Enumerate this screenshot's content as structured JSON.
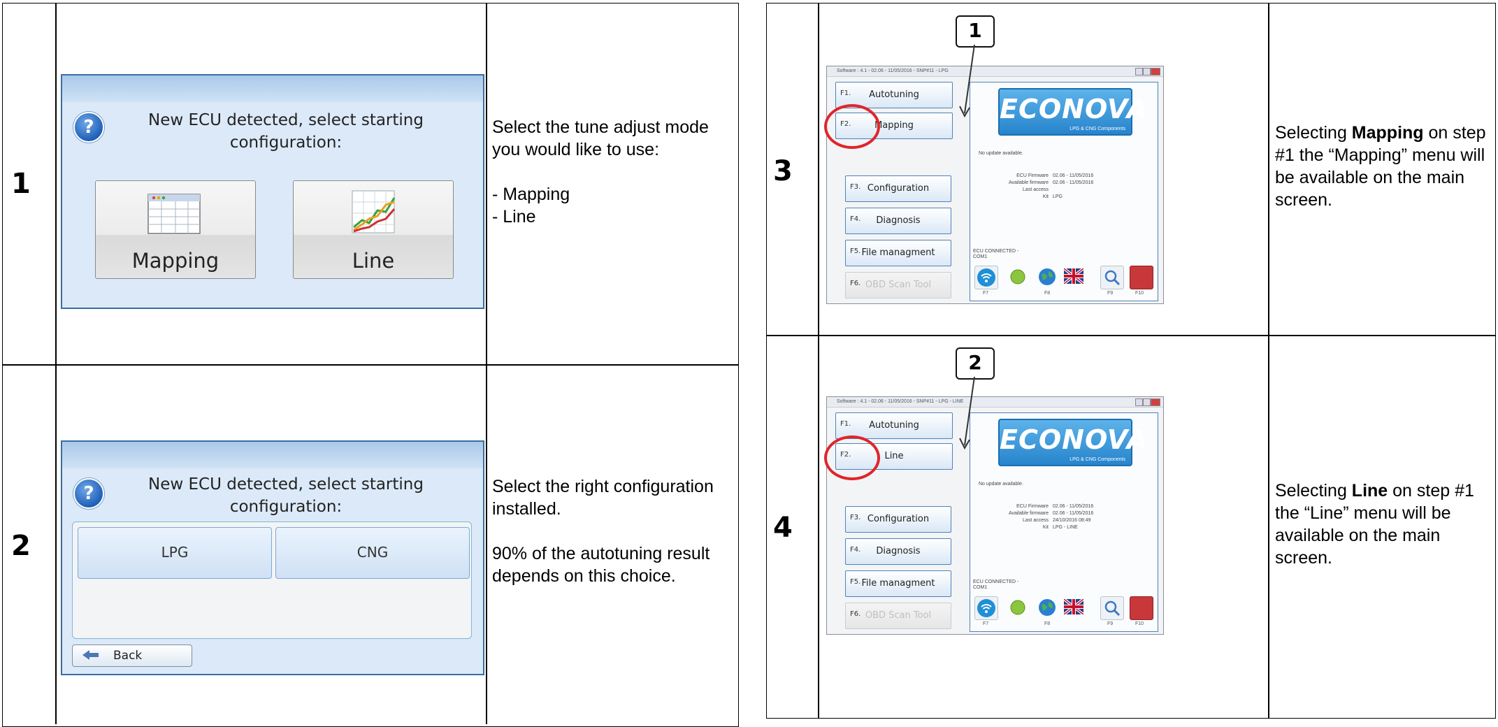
{
  "left_table": {
    "rows": [
      {
        "step": "1",
        "dialog": {
          "help_icon": "question-icon",
          "title": "New ECU detected, select starting\nconfiguration:",
          "buttons": [
            "Mapping",
            "Line"
          ]
        },
        "description": "Select the tune adjust mode you would like to use:\n\n- Mapping\n- Line"
      },
      {
        "step": "2",
        "dialog": {
          "help_icon": "question-icon",
          "title": "New ECU detected, select starting\nconfiguration:",
          "buttons": [
            "LPG",
            "CNG"
          ],
          "back": "Back"
        },
        "description": "Select the right configuration installed.\n\n90% of the autotuning result depends on this choice."
      }
    ]
  },
  "right_table": {
    "rows": [
      {
        "step": "3",
        "callout": "1",
        "app": {
          "title": "Software : 4.1 - 02.06 - 11/05/2016 - SNP#11 - LPG",
          "fbuttons": [
            {
              "key": "F1.",
              "label": "Autotuning"
            },
            {
              "key": "F2.",
              "label": "Mapping"
            },
            {
              "key": "F3.",
              "label": "Configuration"
            },
            {
              "key": "F4.",
              "label": "Diagnosis"
            },
            {
              "key": "F5.",
              "label": "File managment"
            },
            {
              "key": "F6.",
              "label": "OBD Scan Tool"
            }
          ],
          "logo": "ECONOVA",
          "logo_sub": "LPG & CNG Components",
          "update": "No update available.",
          "info": [
            {
              "k": "ECU Firmware",
              "v": "02.06 - 11/05/2016"
            },
            {
              "k": "Available firmware",
              "v": "02.06 - 11/05/2016"
            },
            {
              "k": "Last access",
              "v": ""
            },
            {
              "k": "Kit",
              "v": "LPG"
            }
          ],
          "status": "ECU   CONNECTED   -",
          "com": "COM1",
          "fkeys": [
            "F7",
            "F8",
            "F9",
            "F10"
          ]
        },
        "description_pre": "Selecting ",
        "description_bold": "Mapping",
        "description_post": " on step #1 the “Mapping” menu will be available on the main screen."
      },
      {
        "step": "4",
        "callout": "2",
        "app": {
          "title": "Software : 4.1 - 02.06 - 11/05/2016 - SNP#11 - LPG - LINE",
          "fbuttons": [
            {
              "key": "F1.",
              "label": "Autotuning"
            },
            {
              "key": "F2.",
              "label": "Line"
            },
            {
              "key": "F3.",
              "label": "Configuration"
            },
            {
              "key": "F4.",
              "label": "Diagnosis"
            },
            {
              "key": "F5.",
              "label": "File managment"
            },
            {
              "key": "F6.",
              "label": "OBD Scan Tool"
            }
          ],
          "logo": "ECONOVA",
          "logo_sub": "LPG & CNG Components",
          "update": "No update available.",
          "info": [
            {
              "k": "ECU Firmware",
              "v": "02.06 - 11/05/2016"
            },
            {
              "k": "Available firmware",
              "v": "02.06 - 11/05/2016"
            },
            {
              "k": "Last access",
              "v": "24/10/2016 08:49"
            },
            {
              "k": "Kit",
              "v": "LPG - LINE"
            }
          ],
          "status": "ECU   CONNECTED   -",
          "com": "COM1",
          "fkeys": [
            "F7",
            "F8",
            "F9",
            "F10"
          ]
        },
        "description_pre": "Selecting ",
        "description_bold": "Line",
        "description_post": " on step #1 the “Line” menu will be available on the main screen."
      }
    ]
  }
}
